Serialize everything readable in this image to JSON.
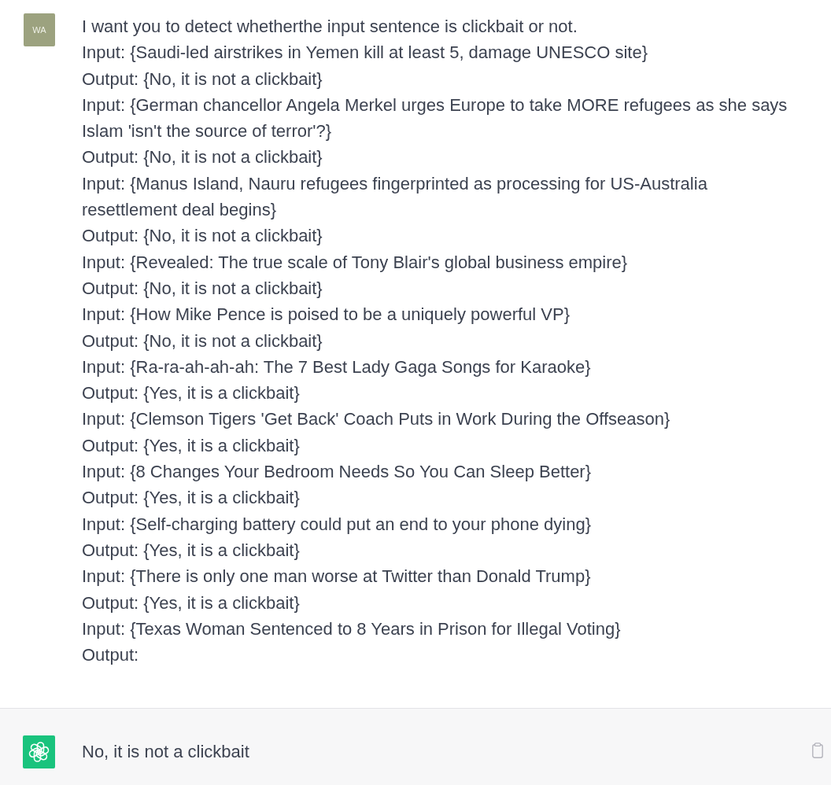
{
  "messages": [
    {
      "kind": "user",
      "avatar": "WA",
      "lines": [
        "I want you to detect whetherthe input sentence is clickbait or not.",
        "Input: {Saudi-led airstrikes in Yemen kill at least 5, damage UNESCO site}",
        "Output: {No, it is not a clickbait}",
        "Input: {German chancellor Angela Merkel urges Europe to take MORE refugees as she says Islam 'isn't the source of terror'?}",
        "Output: {No, it is not a clickbait}",
        "Input: {Manus Island, Nauru refugees fingerprinted as processing for US-Australia resettlement deal begins}",
        "Output: {No, it is not a clickbait}",
        "Input: {Revealed: The true scale of Tony Blair's global business empire}",
        "Output: {No, it is not a clickbait}",
        "Input: {How Mike Pence is poised to be a uniquely powerful VP}",
        "Output: {No, it is not a clickbait}",
        "Input: {Ra-ra-ah-ah-ah: The 7 Best Lady Gaga Songs for Karaoke}",
        "Output: {Yes, it is a clickbait}",
        "Input: {Clemson Tigers 'Get Back' Coach Puts in Work During the Offseason}",
        "Output: {Yes, it is a clickbait}",
        "Input: {8 Changes Your Bedroom Needs So You Can Sleep Better}",
        "Output: {Yes, it is a clickbait}",
        "Input: {Self-charging battery could put an end to your phone dying}",
        "Output: {Yes, it is a clickbait}",
        "Input: {There is only one man worse at Twitter than Donald Trump}",
        "Output: {Yes, it is a clickbait}",
        "Input: {Texas Woman Sentenced to 8 Years in Prison for Illegal Voting}",
        "Output:"
      ]
    },
    {
      "kind": "assistant",
      "lines": [
        "No, it is not a clickbait"
      ]
    }
  ]
}
